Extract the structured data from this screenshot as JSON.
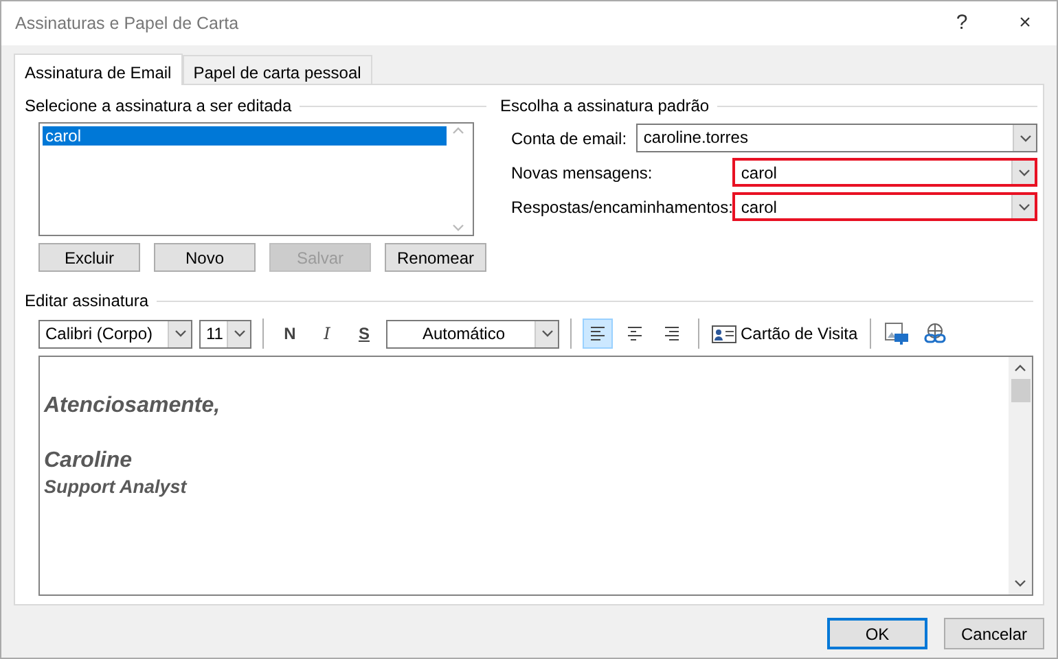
{
  "window": {
    "title": "Assinaturas e Papel de Carta",
    "help_button": "?",
    "close_button": "×"
  },
  "tabs": [
    {
      "label": "Assinatura de Email",
      "selected": true
    },
    {
      "label": "Papel de carta pessoal",
      "selected": false
    }
  ],
  "signatures": {
    "heading": "Selecione a assinatura a ser editada",
    "items": [
      {
        "label": "carol",
        "selected": true
      }
    ],
    "buttons": [
      {
        "label": "Excluir",
        "disabled": false
      },
      {
        "label": "Novo",
        "disabled": false
      },
      {
        "label": "Salvar",
        "disabled": true
      },
      {
        "label": "Renomear",
        "disabled": false
      }
    ]
  },
  "defaults": {
    "heading": "Escolha a assinatura padrão",
    "fields": [
      {
        "label": "Conta de email:",
        "value": "caroline.torres",
        "kind": "wide",
        "highlighted": false
      },
      {
        "label": "Novas mensagens:",
        "value": "carol",
        "kind": "narrow",
        "highlighted": true
      },
      {
        "label": "Respostas/encaminhamentos:",
        "value": "carol",
        "kind": "narrow",
        "highlighted": true
      }
    ]
  },
  "editor": {
    "heading": "Editar assinatura",
    "font": "Calibri (Corpo)",
    "size": "11",
    "format_buttons": [
      {
        "label": "N",
        "kind": "bold"
      },
      {
        "label": "I",
        "kind": "italic"
      },
      {
        "label": "S",
        "kind": "underline"
      }
    ],
    "text_color_choice": "Automático",
    "alignments": [
      {
        "kind": "left",
        "selected": true
      },
      {
        "kind": "center",
        "selected": false
      },
      {
        "kind": "right",
        "selected": false
      }
    ],
    "business_card": "Cartão de Visita",
    "lines": [
      {
        "text": "Atenciosamente,",
        "kind": "large"
      },
      {
        "text": "Caroline",
        "kind": "large"
      },
      {
        "text": "Support Analyst",
        "kind": "small"
      }
    ]
  },
  "buttons": [
    {
      "label": "OK",
      "default": true
    },
    {
      "label": "Cancelar",
      "default": false
    }
  ]
}
